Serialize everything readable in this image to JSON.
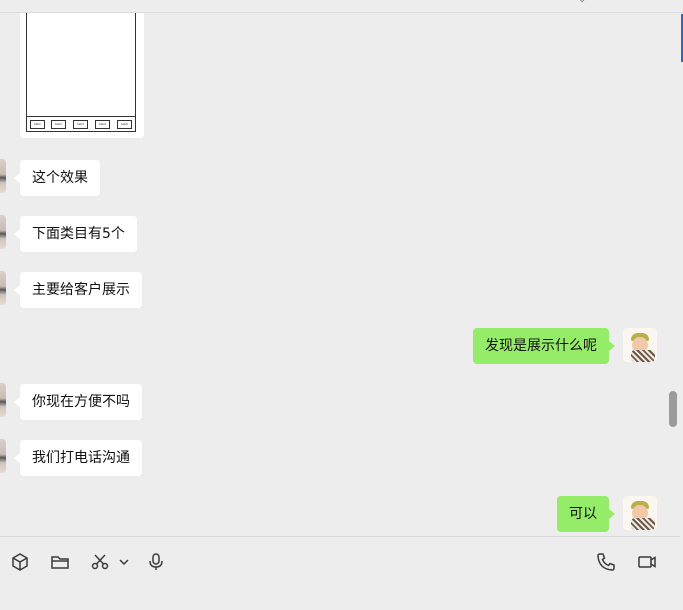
{
  "window": {
    "top_chevron": "⌄"
  },
  "image_message": {
    "thumbnail_buttons": [
      "tab1",
      "tab2",
      "tab3",
      "tab4",
      "tab5"
    ]
  },
  "messages": [
    {
      "side": "left",
      "text": "这个效果"
    },
    {
      "side": "left",
      "text": "下面类目有5个"
    },
    {
      "side": "left",
      "text": "主要给客户展示"
    },
    {
      "side": "right",
      "text": "发现是展示什么呢"
    },
    {
      "side": "left",
      "text": "你现在方便不吗"
    },
    {
      "side": "left",
      "text": "我们打电话沟通"
    },
    {
      "side": "right",
      "text": "可以"
    }
  ],
  "toolbar": {
    "icons": [
      "cube-icon",
      "folder-icon",
      "scissors-icon",
      "chevron-down-icon",
      "microphone-icon",
      "phone-icon",
      "video-camera-icon"
    ]
  },
  "colors": {
    "background": "#ededed",
    "incoming_bubble": "#ffffff",
    "outgoing_bubble": "#95ec69",
    "accent": "#2b6cb0"
  }
}
